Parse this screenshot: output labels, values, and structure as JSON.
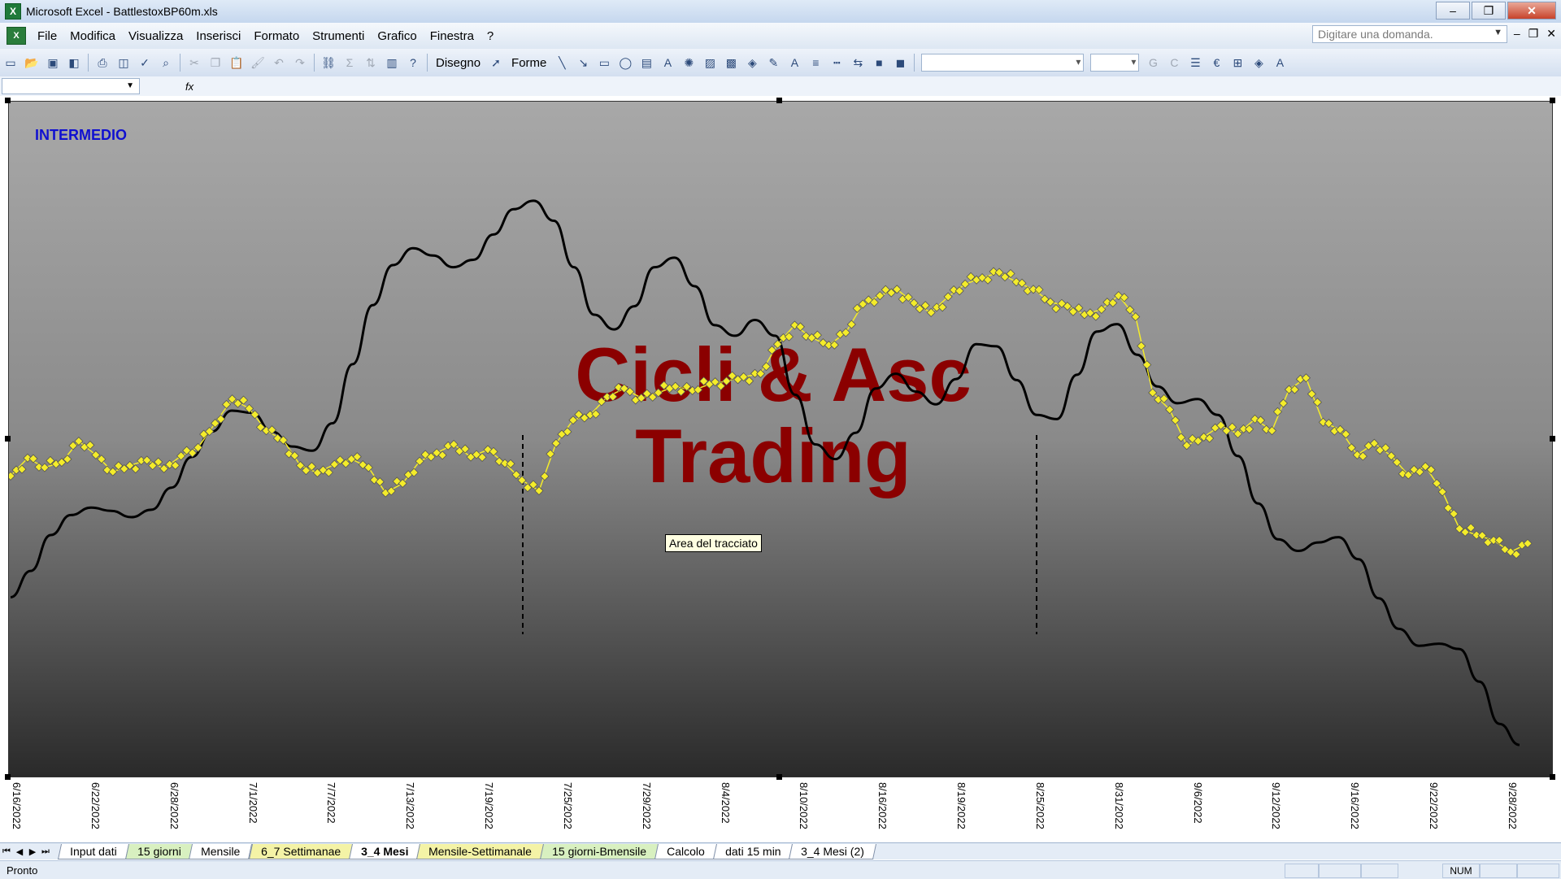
{
  "window": {
    "title": "Microsoft Excel - BattlestoxBP60m.xls",
    "minimize": "–",
    "restore": "❐",
    "close": "✕"
  },
  "menu": {
    "items": [
      "File",
      "Modifica",
      "Visualizza",
      "Inserisci",
      "Formato",
      "Strumenti",
      "Grafico",
      "Finestra",
      "?"
    ],
    "ask_placeholder": "Digitare una domanda.",
    "doc_minimize": "–",
    "doc_restore": "❐",
    "doc_close": "✕"
  },
  "toolbar": {
    "draw_label": "Disegno",
    "shapes_label": "Forme",
    "bold": "G",
    "italic": "C",
    "euro": "€"
  },
  "formula": {
    "fx": "fx"
  },
  "chart": {
    "label_intermedio": "INTERMEDIO",
    "watermark_line1": "Cicli & Asc",
    "watermark_line2": "Trading",
    "tooltip": "Area del tracciato",
    "colors": {
      "price": "#f4ec2a",
      "cycle": "#000000",
      "watermark": "#8b0000",
      "intermedio": "#1010d0"
    }
  },
  "chart_data": {
    "type": "line",
    "x_tick_labels": [
      "6/16/2022",
      "6/22/2022",
      "6/28/2022",
      "7/1/2022",
      "7/7/2022",
      "7/13/2022",
      "7/19/2022",
      "7/25/2022",
      "7/29/2022",
      "8/4/2022",
      "8/10/2022",
      "8/16/2022",
      "8/19/2022",
      "8/25/2022",
      "8/31/2022",
      "9/6/2022",
      "9/12/2022",
      "9/16/2022",
      "9/22/2022",
      "9/28/2022"
    ],
    "series": [
      {
        "color": "#f4ec2a",
        "marker": "diamond",
        "values": [
          28.5,
          30.2,
          29.3,
          29.8,
          31.8,
          30.5,
          28.9,
          29.5,
          30.0,
          29.2,
          30.4,
          31.2,
          33.5,
          35.8,
          34.9,
          32.8,
          31.9,
          29.5,
          28.8,
          29.6,
          30.1,
          29.3,
          26.9,
          27.8,
          29.9,
          30.7,
          31.5,
          30.3,
          31.0,
          29.7,
          28.1,
          27.1,
          31.6,
          33.8,
          34.3,
          36.0,
          36.8,
          35.9,
          36.4,
          37.0,
          36.6,
          37.2,
          37.5,
          37.9,
          38.2,
          41.0,
          42.8,
          41.6,
          40.9,
          42.1,
          44.8,
          45.6,
          46.2,
          44.9,
          44.0,
          45.5,
          46.7,
          47.3,
          47.8,
          46.9,
          46.2,
          45.0,
          44.6,
          43.8,
          44.3,
          45.6,
          43.6,
          36.4,
          34.8,
          31.4,
          32.2,
          33.3,
          32.5,
          33.9,
          32.8,
          36.7,
          37.8,
          33.6,
          32.9,
          30.5,
          31.6,
          30.4,
          28.6,
          29.4,
          27.0,
          23.5,
          22.9,
          22.4,
          21.3,
          22.1
        ]
      },
      {
        "color": "#000000",
        "values": [
          17.0,
          19.5,
          22.9,
          24.8,
          25.5,
          25.2,
          24.6,
          25.3,
          27.4,
          30.3,
          32.7,
          34.7,
          34.5,
          32.7,
          31.3,
          30.9,
          33.5,
          39.1,
          44.7,
          48.5,
          50.1,
          49.4,
          48.3,
          49.0,
          51.4,
          53.8,
          54.6,
          52.7,
          48.3,
          43.8,
          42.4,
          44.6,
          48.3,
          49.2,
          46.5,
          42.8,
          41.8,
          43.3,
          41.8,
          36.2,
          31.5,
          30.1,
          32.6,
          36.8,
          38.2,
          36.5,
          35.3,
          37.7,
          41.0,
          40.8,
          37.6,
          34.3,
          33.9,
          38.1,
          42.2,
          42.9,
          40.0,
          37.0,
          35.4,
          35.8,
          34.3,
          30.4,
          25.9,
          22.5,
          21.4,
          22.2,
          22.7,
          20.6,
          16.9,
          14.0,
          12.4,
          12.6,
          12.1,
          9.0,
          5.0,
          3.0
        ]
      }
    ],
    "ylim": [
      0,
      64
    ],
    "grid": false,
    "legend": "none",
    "annotations": [
      "INTERMEDIO",
      "Cicli & Asc",
      "Trading"
    ]
  },
  "sheet_tabs": [
    {
      "label": "Input dati",
      "style": "plain"
    },
    {
      "label": "15 giorni",
      "style": "green"
    },
    {
      "label": "Mensile",
      "style": "plain"
    },
    {
      "label": "6_7 Settimanae",
      "style": "yellow"
    },
    {
      "label": "3_4 Mesi",
      "style": "active"
    },
    {
      "label": "Mensile-Settimanale",
      "style": "yellow"
    },
    {
      "label": "15 giorni-Bmensile",
      "style": "green"
    },
    {
      "label": "Calcolo",
      "style": "plain"
    },
    {
      "label": "dati 15 min",
      "style": "plain"
    },
    {
      "label": "3_4 Mesi (2)",
      "style": "plain"
    }
  ],
  "status": {
    "ready": "Pronto",
    "num": "NUM"
  }
}
